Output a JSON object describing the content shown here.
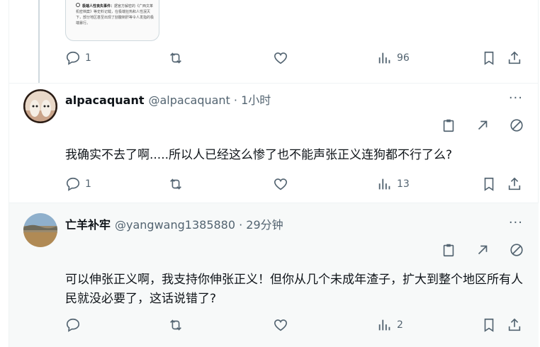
{
  "top_card": {
    "line1_bold": "极端人性丧失事件：",
    "line1": "据官方解密的《广西文革机密档案》等史料记载，在极端狂热和人性泯灭下，部分地区甚至出现了刮腹剜肝等令人发指的极端暴行。"
  },
  "top_actions": {
    "replies": "1",
    "views": "96"
  },
  "tweets": [
    {
      "name": "alpacaquant",
      "handle": "@alpacaquant · 1小时",
      "text": "我确实不去了啊.....所以人已经这么惨了也不能声张正义连狗都不行了么?",
      "replies": "1",
      "views": "13"
    },
    {
      "name": "亡羊补牢",
      "handle": "@yangwang1385880 · 29分钟",
      "text": "可以伸张正义啊，我支持你伸张正义！但你从几个未成年渣子，扩大到整个地区所有人民就没必要了，这话说错了?",
      "replies": "",
      "views": "2"
    }
  ],
  "more_label": "···"
}
